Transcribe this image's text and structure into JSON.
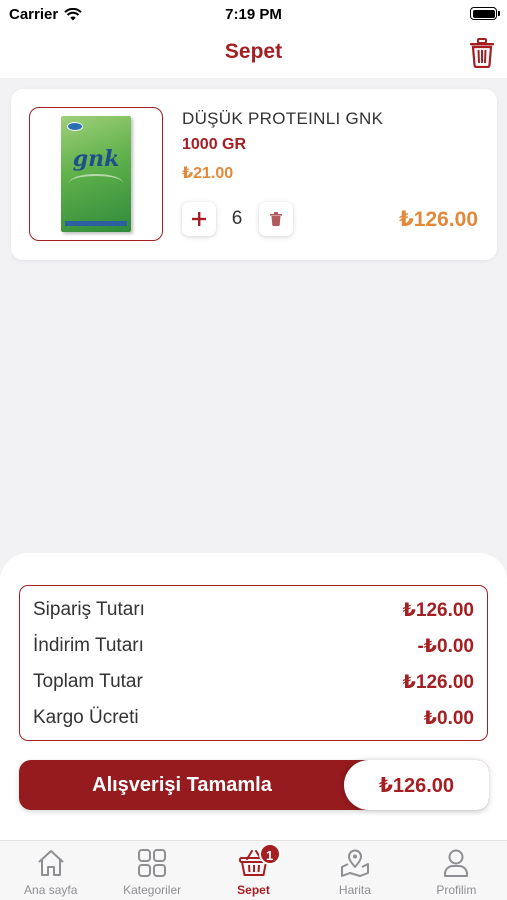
{
  "status_bar": {
    "carrier": "Carrier",
    "time": "7:19 PM"
  },
  "header": {
    "title": "Sepet"
  },
  "cart_item": {
    "name": "DÜŞÜK PROTEINLI GNK",
    "weight": "1000 GR",
    "unit_price": "₺21.00",
    "quantity": "6",
    "total": "₺126.00",
    "image_brand": "gnk"
  },
  "summary": {
    "rows": [
      {
        "label": "Sipariş Tutarı",
        "value": "₺126.00"
      },
      {
        "label": "İndirim Tutarı",
        "value": "-₺0.00"
      },
      {
        "label": "Toplam Tutar",
        "value": "₺126.00"
      },
      {
        "label": "Kargo Ücreti",
        "value": "₺0.00"
      }
    ]
  },
  "checkout": {
    "label": "Alışverişi Tamamla",
    "amount": "₺126.00"
  },
  "tabs": [
    {
      "label": "Ana sayfa",
      "icon": "home-icon"
    },
    {
      "label": "Kategoriler",
      "icon": "grid-icon"
    },
    {
      "label": "Sepet",
      "icon": "basket-icon",
      "badge": "1"
    },
    {
      "label": "Harita",
      "icon": "map-icon"
    },
    {
      "label": "Profilim",
      "icon": "user-icon"
    }
  ],
  "colors": {
    "accent": "#a41e22",
    "price": "#e2893a",
    "background": "#f2f2f4"
  }
}
